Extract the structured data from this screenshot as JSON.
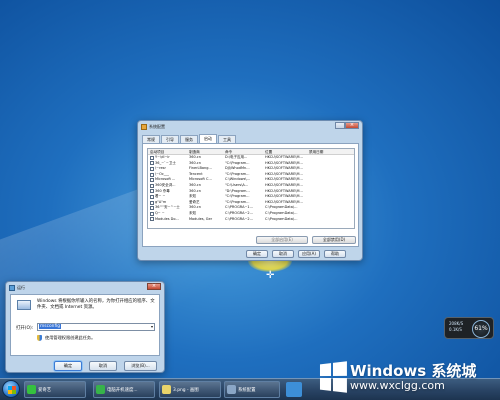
{
  "syscfg": {
    "title": "系统配置",
    "tabs": [
      "常规",
      "引导",
      "服务",
      "启动",
      "工具"
    ],
    "active_tab": "启动",
    "columns": [
      "启动项目",
      "制造商",
      "命令",
      "位置",
      "禁用日期"
    ],
    "rows": [
      {
        "name": "Y~\\dl~ir",
        "maker": "360.cn",
        "cmd": "D:\\电子应用...",
        "loc": "HKCU\\SOFTWARE\\M..."
      },
      {
        "name": "36_~`~卫士",
        "maker": "360.cn",
        "cmd": "\"C:\\Program...",
        "loc": "HKCU\\SOFTWARE\\M..."
      },
      {
        "name": "\\~resr",
        "maker": "FinerLBang...",
        "cmd": "DJJ\\WhodMn...",
        "loc": "HKCU\\SOFTWARE\\M..."
      },
      {
        "name": "\\~Oc___",
        "maker": "Tencent",
        "cmd": "\"C:\\Program...",
        "loc": "HKCU\\SOFTWARE\\M..."
      },
      {
        "name": "Microsoft ...",
        "maker": "Microsoft C...",
        "cmd": "C:\\Windows\\...",
        "loc": "HKCU\\SOFTWARE\\M..."
      },
      {
        "name": "360安全浏...",
        "maker": "360.cn",
        "cmd": "\"C:\\Users\\A...",
        "loc": "HKCU\\SOFTWARE\\M..."
      },
      {
        "name": "360 杀毒",
        "maker": "360.cn",
        "cmd": "\"D:\\Program...",
        "loc": "HKCU\\SOFTWARE\\M..."
      },
      {
        "name": "看~ ~",
        "maker": "未知",
        "cmd": "\"C:\\Program...",
        "loc": "HKCU\\SOFTWARE\\M..."
      },
      {
        "name": "g\"A\"m",
        "maker": "爱奇艺",
        "cmd": "\"C:\\Program...",
        "loc": "HKCU\\SOFTWARE\\M..."
      },
      {
        "name": "36^\"安~^~士",
        "maker": "360.cn",
        "cmd": "C:\\PROGRA~1...",
        "loc": "C:\\ProgramData\\..."
      },
      {
        "name": "Q~ ~",
        "maker": "未知",
        "cmd": "C:\\PROGRA~2...",
        "loc": "C:\\ProgramData\\..."
      },
      {
        "name": "Modules Do...",
        "maker": "Modules, Ger",
        "cmd": "C:\\PROGRA~2...",
        "loc": "C:\\ProgramData\\..."
      }
    ],
    "enable_all": "全部启用(E)",
    "disable_all": "全部禁用(D)",
    "ok": "确定",
    "cancel": "取消",
    "apply": "应用(A)",
    "help": "帮助"
  },
  "run": {
    "title": "运行",
    "description": "Windows 将根据你所输入的名称，为你打开相应的程序、文件夹、文档或 Internet 资源。",
    "open_label": "打开(O):",
    "open_value": "msconfig",
    "admin_note": "使用管理权限创建此任务。",
    "ok": "确定",
    "cancel": "取消",
    "browse": "浏览(B)..."
  },
  "gadget": {
    "line1": "208K/S",
    "line2": "0.1K/S",
    "percent": "61%"
  },
  "taskbar": {
    "apps": [
      "爱奇艺",
      "电脑开机速度...",
      "3.png - 画图",
      "系统配置"
    ]
  },
  "watermark": {
    "title": "Windows 系统城",
    "url": "www.wxclgg.com"
  },
  "colors": {
    "desktop": "#1f6fbf",
    "taskbar": "#2a4566",
    "selection": "#3875d7"
  }
}
